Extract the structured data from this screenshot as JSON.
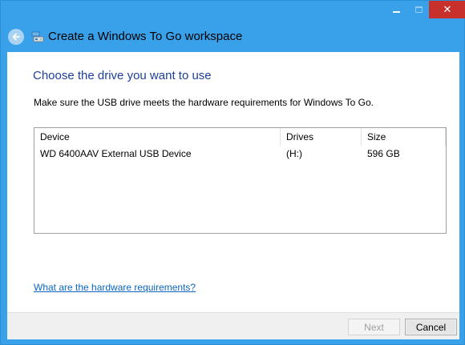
{
  "window": {
    "title": "Create a Windows To Go workspace",
    "minimize_glyph": "",
    "close_glyph": "✕"
  },
  "page": {
    "heading": "Choose the drive you want to use",
    "description": "Make sure the USB drive meets the hardware requirements for Windows To Go.",
    "table": {
      "columns": [
        "Device",
        "Drives",
        "Size"
      ],
      "rows": [
        [
          "WD 6400AAV External USB Device",
          "(H:)",
          "596 GB"
        ]
      ]
    },
    "hardware_link": "What are the hardware requirements?"
  },
  "footer": {
    "next_label": "Next",
    "cancel_label": "Cancel"
  },
  "icons": {
    "back": "back-arrow-icon",
    "wizard": "usb-drive-icon",
    "minimize": "minimize-icon",
    "maximize": "maximize-icon",
    "close": "close-icon"
  },
  "colors": {
    "frame": "#39a1ea",
    "close_button": "#c7302b",
    "heading": "#1e3f9a",
    "link": "#0a66c2"
  }
}
